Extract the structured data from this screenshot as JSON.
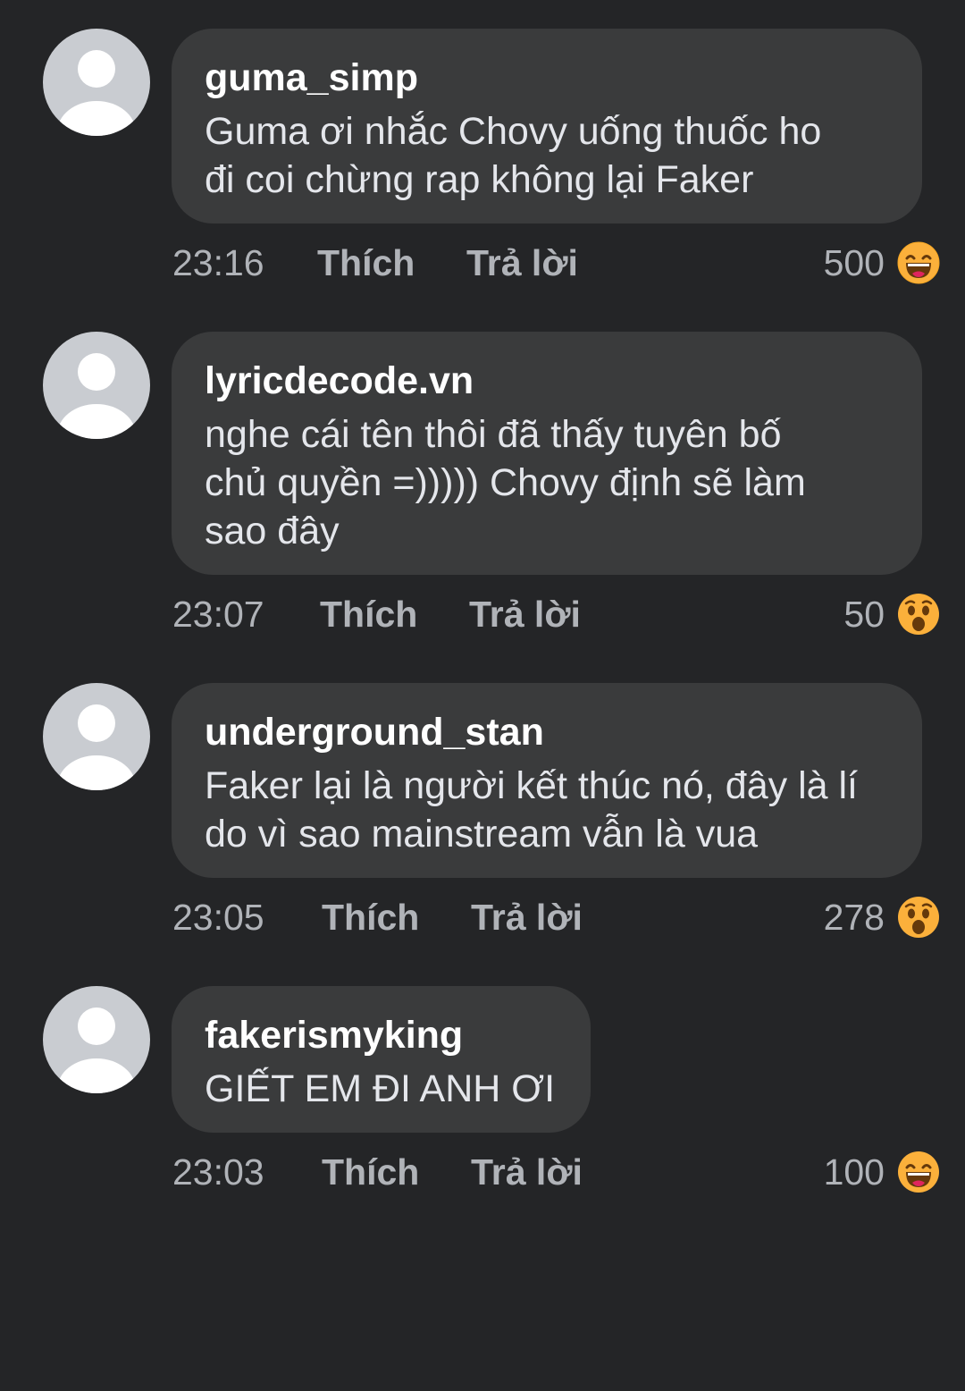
{
  "comments": [
    {
      "username": "guma_simp",
      "lines": [
        "Guma ơi nhắc Chovy uống thuốc ho",
        "đi coi chừng rap không lại Faker"
      ],
      "time": "23:16",
      "like_label": "Thích",
      "reply_label": "Trả lời",
      "reaction_count": "500",
      "reaction_icon": "laughing-emoji-icon"
    },
    {
      "username": "lyricdecode.vn",
      "lines": [
        "nghe cái tên thôi đã thấy tuyên bố",
        "chủ quyền =))))) Chovy định sẽ làm",
        "sao đây"
      ],
      "time": "23:07",
      "like_label": "Thích",
      "reply_label": "Trả lời",
      "reaction_count": "50",
      "reaction_icon": "wow-emoji-icon"
    },
    {
      "username": "underground_stan",
      "lines": [
        "Faker lại là người kết thúc nó, đây là lí",
        "do vì sao mainstream vẫn là vua"
      ],
      "time": "23:05",
      "like_label": "Thích",
      "reply_label": "Trả lời",
      "reaction_count": "278",
      "reaction_icon": "wow-emoji-icon"
    },
    {
      "username": "fakerismyking",
      "lines": [
        "GIẾT EM ĐI ANH ƠI"
      ],
      "time": "23:03",
      "like_label": "Thích",
      "reply_label": "Trả lời",
      "reaction_count": "100",
      "reaction_icon": "laughing-emoji-icon"
    }
  ],
  "colors": {
    "background": "#242527",
    "bubble": "#3a3b3c",
    "meta_text": "#b0b3b8",
    "avatar_bg": "#c9ccd1"
  }
}
